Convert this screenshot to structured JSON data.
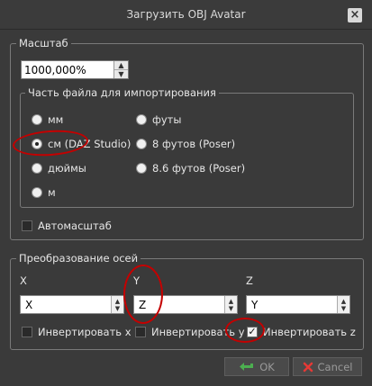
{
  "window": {
    "title": "Загрузить OBJ Avatar",
    "close_glyph": "×"
  },
  "scale": {
    "legend": "Масштаб",
    "value": "1000,000%",
    "import_part": {
      "legend": "Часть файла для импортирования",
      "options": [
        {
          "label": "мм",
          "checked": false
        },
        {
          "label": "см (DAZ Studio)",
          "checked": true
        },
        {
          "label": "дюймы",
          "checked": false
        },
        {
          "label": "м",
          "checked": false
        },
        {
          "label": "футы",
          "checked": false
        },
        {
          "label": "8 футов (Poser)",
          "checked": false
        },
        {
          "label": "8.6 футов (Poser)",
          "checked": false
        }
      ]
    },
    "autoscale_label": "Автомасштаб"
  },
  "axes": {
    "legend": "Преобразование осей",
    "columns": [
      {
        "label": "X",
        "value": "X",
        "invert_label": "Инвертировать x",
        "invert_checked": false
      },
      {
        "label": "Y",
        "value": "Z",
        "invert_label": "Инвертировать y",
        "invert_checked": false
      },
      {
        "label": "Z",
        "value": "Y",
        "invert_label": "Инвертировать z",
        "invert_checked": true
      }
    ]
  },
  "buttons": {
    "ok": "OK",
    "cancel": "Cancel"
  },
  "colors": {
    "annotation_red": "#c40000",
    "ok_icon_green": "#4caf50",
    "cancel_icon_red": "#e53935"
  }
}
